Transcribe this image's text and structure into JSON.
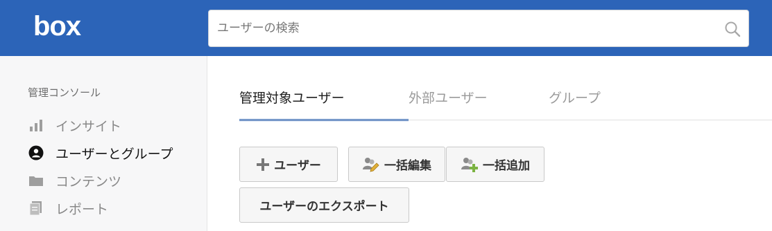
{
  "header": {
    "logo_text": "box",
    "search_placeholder": "ユーザーの検索",
    "search_icon": "search-icon"
  },
  "sidebar": {
    "heading": "管理コンソール",
    "items": [
      {
        "label": "インサイト",
        "icon": "bar-chart-icon",
        "active": false
      },
      {
        "label": "ユーザーとグループ",
        "icon": "user-circle-icon",
        "active": true
      },
      {
        "label": "コンテンツ",
        "icon": "folder-icon",
        "active": false
      },
      {
        "label": "レポート",
        "icon": "report-icon",
        "active": false
      }
    ]
  },
  "tabs": [
    {
      "label": "管理対象ユーザー",
      "active": true
    },
    {
      "label": "外部ユーザー",
      "active": false
    },
    {
      "label": "グループ",
      "active": false
    }
  ],
  "toolbar": {
    "add_user": "ユーザー",
    "bulk_edit": "一括編集",
    "bulk_add": "一括追加",
    "export_users": "ユーザーのエクスポート"
  },
  "colors": {
    "brand_blue": "#2c64b8",
    "sidebar_bg": "#f7f7f8",
    "add_green": "#7cb342"
  }
}
